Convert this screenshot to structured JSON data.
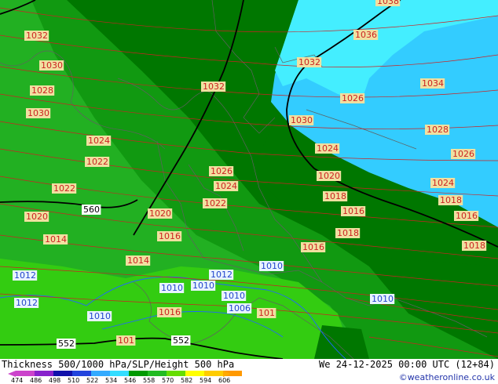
{
  "footer": {
    "title": "Thickness 500/1000 hPa/SLP/Height 500 hPa",
    "datetime": "We 24-12-2025 00:00 UTC (12+84)",
    "credit": "©weatheronline.co.uk"
  },
  "legend": {
    "ticks": [
      "474",
      "486",
      "498",
      "510",
      "522",
      "534",
      "546",
      "558",
      "570",
      "582",
      "594",
      "606"
    ],
    "colors": [
      "#cc44cc",
      "#8822cc",
      "#1111aa",
      "#2244dd",
      "#33aaff",
      "#33ddff",
      "#009900",
      "#22bb22",
      "#66dd00",
      "#ffff00",
      "#ffcc00",
      "#ff9900"
    ]
  },
  "map": {
    "colors": {
      "band_light": "#22b022",
      "band_mid": "#119911",
      "band_dark": "#007700",
      "band_cyan": "#33ccff",
      "band_cyan_light": "#44eeff",
      "band_bright": "#33cc11",
      "isobar": "#cc2222",
      "isohypse": "#000000",
      "contour_blue": "#2266ff",
      "label_bg": "#f0e0a0",
      "label_text": "#cc2222",
      "label_text_blue": "#2244cc",
      "border": "#606060"
    },
    "isobar_labels": [
      "1038",
      "1032",
      "1036",
      "1030",
      "1032",
      "1034",
      "1028",
      "1032",
      "1026",
      "1030",
      "1030",
      "1024",
      "1028",
      "1022",
      "1024",
      "1026",
      "1026",
      "1020",
      "1022",
      "1024",
      "1024",
      "1018",
      "1018",
      "1020",
      "1022",
      "1016",
      "1016",
      "1020",
      "1014",
      "1016",
      "1018",
      "1014",
      "1016",
      "1018",
      "1012",
      "1012",
      "1010",
      "1010",
      "1012",
      "1010",
      "1010",
      "1010",
      "1010",
      "1006",
      "1016",
      "101",
      "101"
    ],
    "height_labels": [
      "560",
      "552",
      "552"
    ]
  }
}
